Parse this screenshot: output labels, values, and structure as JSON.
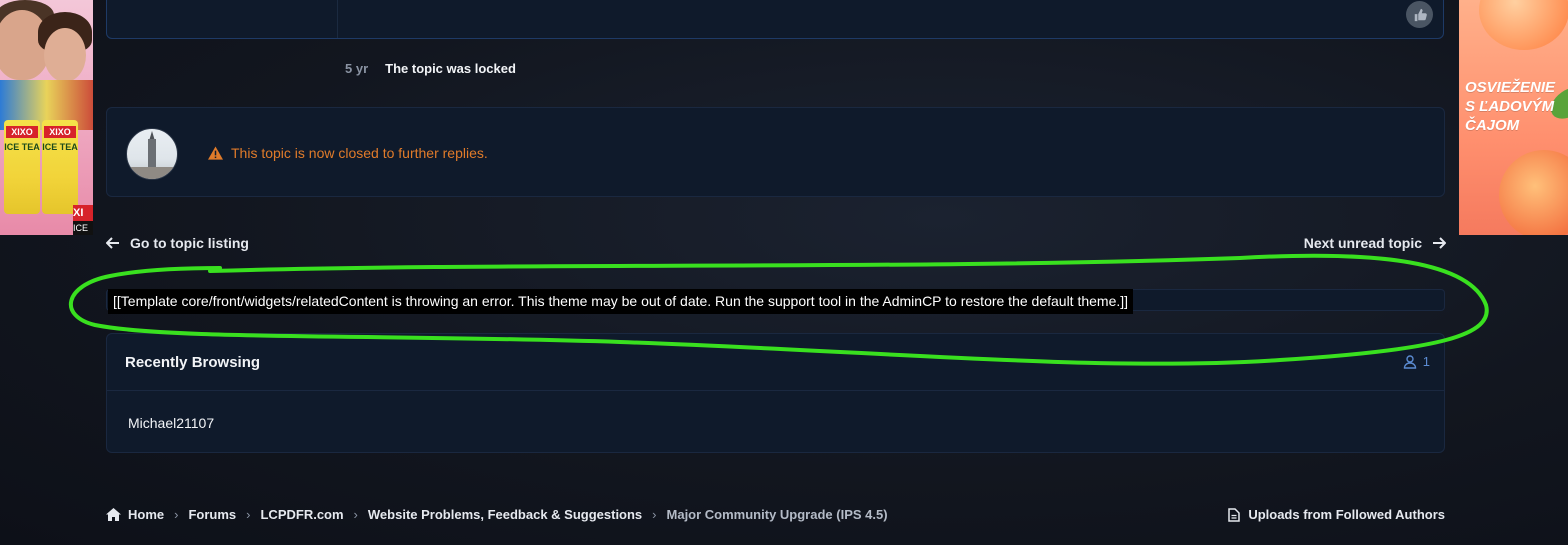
{
  "ads": {
    "left": {
      "brand": "XIXO",
      "can_text": "ICE TEA",
      "corner_brand": "XI",
      "corner_sub": "ICE"
    },
    "right": {
      "slogan": "OSVIEŽENIE S ĽADOVÝM ČAJOM"
    }
  },
  "event": {
    "time": "5 yr",
    "text": "The topic was locked"
  },
  "closed_notice": {
    "message": "This topic is now closed to further replies."
  },
  "topic_nav": {
    "prev_label": "Go to topic listing",
    "next_label": "Next unread topic"
  },
  "widget_error": {
    "text": "[[Template core/front/widgets/relatedContent is throwing an error. This theme may be out of date. Run the support tool in the AdminCP to restore the default theme.]]"
  },
  "recently_browsing": {
    "title": "Recently Browsing",
    "count": "1",
    "users": [
      "Michael21107"
    ]
  },
  "breadcrumb": {
    "items": [
      "Home",
      "Forums",
      "LCPDFR.com",
      "Website Problems, Feedback & Suggestions",
      "Major Community Upgrade (IPS 4.5)"
    ]
  },
  "footer_link": {
    "label": "Uploads from Followed Authors"
  },
  "colors": {
    "warning": "#e07b2a",
    "accent": "#5b8bd1",
    "annotation": "#39e01f"
  },
  "icons": {
    "like": "thumbs-up-icon",
    "warning": "warning-triangle-icon",
    "prev": "arrow-left-icon",
    "next": "arrow-right-icon",
    "user": "user-icon",
    "home": "home-icon",
    "chevron": "chevron-right-icon",
    "document": "document-icon"
  }
}
